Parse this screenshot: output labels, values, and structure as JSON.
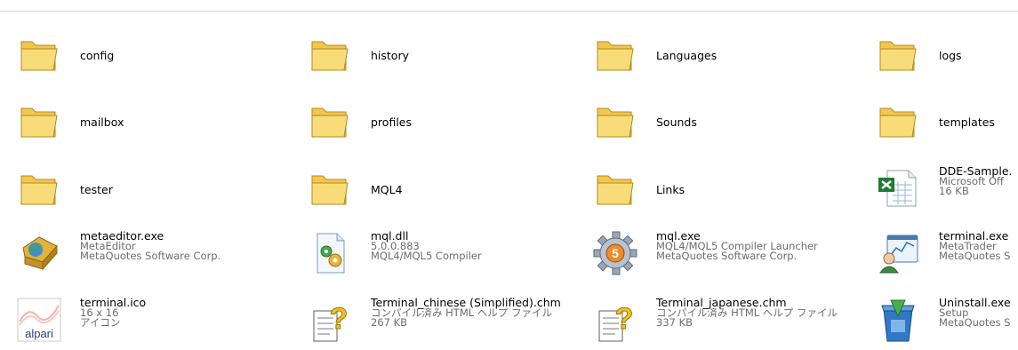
{
  "items": [
    {
      "name": "config"
    },
    {
      "name": "history"
    },
    {
      "name": "Languages"
    },
    {
      "name": "logs"
    },
    {
      "name": "mailbox"
    },
    {
      "name": "profiles"
    },
    {
      "name": "Sounds"
    },
    {
      "name": "templates"
    },
    {
      "name": "tester"
    },
    {
      "name": "MQL4"
    },
    {
      "name": "Links"
    },
    {
      "name": "DDE-Sample.",
      "line2": "Microsoft Off",
      "line3": "16 KB"
    },
    {
      "name": "metaeditor.exe",
      "line2": "MetaEditor",
      "line3": "MetaQuotes Software Corp."
    },
    {
      "name": "mql.dll",
      "line2": "5.0.0.883",
      "line3": "MQL4/MQL5 Compiler"
    },
    {
      "name": "mql.exe",
      "line2": "MQL4/MQL5 Compiler Launcher",
      "line3": "MetaQuotes Software Corp."
    },
    {
      "name": "terminal.exe",
      "line2": "MetaTrader",
      "line3": "MetaQuotes S"
    },
    {
      "name": "terminal.ico",
      "line2": "16 x 16",
      "line3": "アイコン",
      "logo_text": "alpari"
    },
    {
      "name": "Terminal_chinese (Simplified).chm",
      "line2": "コンパイル済み HTML ヘルプ ファイル",
      "line3": "267 KB"
    },
    {
      "name": "Terminal_japanese.chm",
      "line2": "コンパイル済み HTML ヘルプ ファイル",
      "line3": "337 KB"
    },
    {
      "name": "Uninstall.exe",
      "line2": "Setup",
      "line3": "MetaQuotes S"
    }
  ],
  "icons": {
    "folder": "folder-icon",
    "excel": "excel-file-icon",
    "metaeditor": "metaeditor-icon",
    "dll": "dll-file-icon",
    "gear": "gear-icon",
    "terminal": "terminal-exe-icon",
    "ico": "alpari-ico-icon",
    "chm": "help-file-icon",
    "uninstall": "uninstall-icon"
  },
  "colors": {
    "folder_fill": "#f6d56a",
    "meta_text": "#6d6d6d",
    "excel_green": "#1e7b32"
  }
}
